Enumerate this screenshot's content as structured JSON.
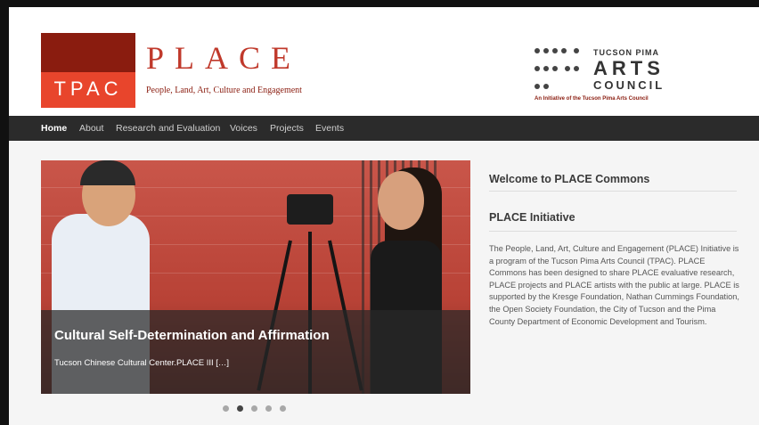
{
  "header": {
    "logo_tpac": "TPAC",
    "title": "PLACE",
    "subtitle": "People, Land, Art, Culture and Engagement",
    "arts_council": {
      "line1": "TUCSON PIMA",
      "line2": "ARTS",
      "line3": "COUNCIL",
      "tagline": "An Initiative of the Tucson Pima Arts Council"
    }
  },
  "nav": {
    "items": [
      {
        "label": "Home",
        "active": true
      },
      {
        "label": "About"
      },
      {
        "label": "Research and Evaluation"
      },
      {
        "label": "Voices"
      },
      {
        "label": "Projects"
      },
      {
        "label": "Events"
      }
    ]
  },
  "slider": {
    "title": "Cultural Self-Determination and Affirmation",
    "text": "Tucson Chinese Cultural Center.PLACE III […]",
    "pager_count": 5,
    "active_index": 1
  },
  "sidebar": {
    "welcome": "Welcome to PLACE Commons",
    "heading": "PLACE Initiative",
    "body": "The People, Land, Art, Culture and Engagement (PLACE) Initiative is a program of the Tucson Pima Arts Council (TPAC). PLACE Commons has been designed to share PLACE evaluative research, PLACE projects and PLACE artists with the public at large. PLACE is supported by the Kresge Foundation, Nathan Cummings Foundation, the Open Society Foundation, the City of Tucson and the Pima County Department of Economic Development and Tourism."
  },
  "colors": {
    "brand_dark": "#8a1c0f",
    "brand_light": "#e8452c",
    "nav_bg": "#2b2b2b"
  }
}
